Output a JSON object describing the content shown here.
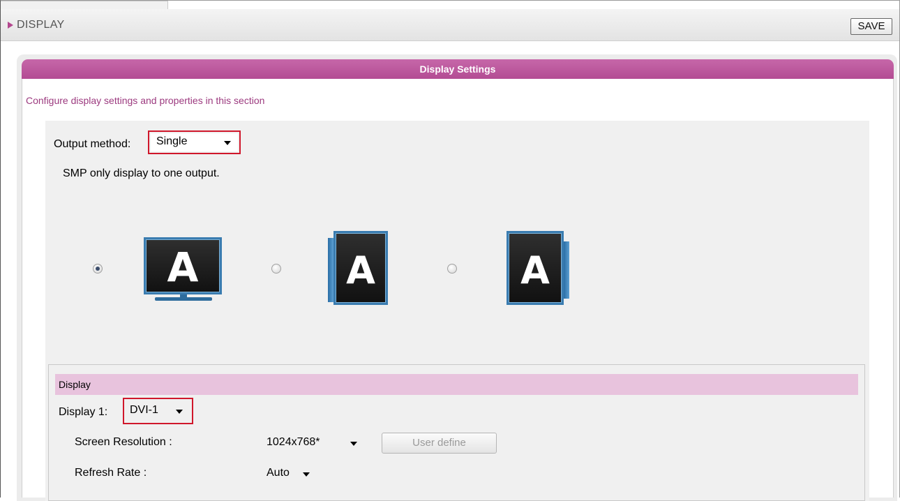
{
  "header": {
    "title": "DISPLAY",
    "save_label": "SAVE"
  },
  "panel": {
    "title": "Display Settings",
    "description": "Configure display settings and properties in this section"
  },
  "output": {
    "label": "Output method:",
    "selected": "Single",
    "hint": "SMP only display to one output.",
    "options_icons": [
      "monitor-landscape-icon",
      "monitor-portrait-left-icon",
      "monitor-portrait-right-icon"
    ],
    "selected_index": 0,
    "icon_letter": "A"
  },
  "display": {
    "section_title": "Display",
    "display1_label": "Display 1:",
    "display1_value": "DVI-1",
    "resolution_label": "Screen Resolution :",
    "resolution_value": "1024x768*",
    "user_define_label": "User define",
    "refresh_label": "Refresh Rate :",
    "refresh_value": "Auto"
  },
  "colors": {
    "accent": "#b34c93",
    "section_header": "#e8c3dd",
    "highlight_border": "#d0172b",
    "monitor_frame": "#3a7cb0"
  }
}
